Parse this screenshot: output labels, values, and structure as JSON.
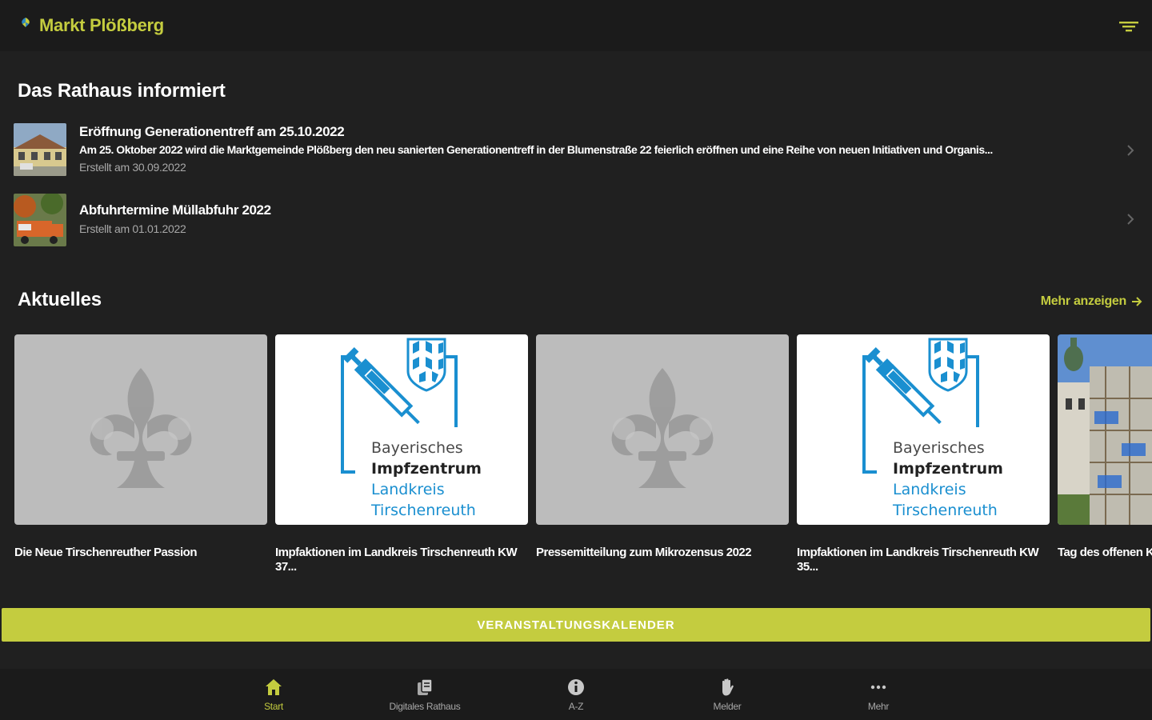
{
  "header": {
    "title": "Markt Plößberg",
    "filter_icon": "filter-icon"
  },
  "rathaus": {
    "title": "Das Rathaus informiert",
    "items": [
      {
        "title": "Eröffnung Generationentreff am 25.10.2022",
        "description": "Am 25. Oktober 2022 wird die Marktgemeinde Plößberg den neu sanierten Generationentreff in der Blumenstraße 22 feierlich eröffnen und eine Reihe von neuen Initiativen und Organis...",
        "date": "Erstellt am 30.09.2022"
      },
      {
        "title": "Abfuhrtermine Müllabfuhr 2022",
        "date": "Erstellt am 01.01.2022"
      }
    ]
  },
  "aktuelles": {
    "title": "Aktuelles",
    "more_label": "Mehr anzeigen",
    "cards": [
      {
        "title": "Die Neue Tirschenreuther Passion",
        "image": "placeholder-fleur-icon"
      },
      {
        "title": "Impfaktionen im Landkreis Tirschenreuth KW 37...",
        "image": "impfzentrum-logo"
      },
      {
        "title": "Pressemitteilung zum Mikrozensus 2022",
        "image": "placeholder-fleur-icon"
      },
      {
        "title": "Impfaktionen im Landkreis Tirschenreuth KW 35...",
        "image": "impfzentrum-logo"
      },
      {
        "title": "Tag des offenen Koopera...",
        "image": "church-photo"
      }
    ],
    "logo_text": {
      "line1": "Bayerisches",
      "line2": "Impfzentrum",
      "line3": "Landkreis",
      "line4": "Tirschenreuth"
    }
  },
  "calendar_button": "VERANSTALTUNGSKALENDER",
  "bottom_nav": [
    {
      "label": "Start",
      "icon": "home-icon",
      "active": true
    },
    {
      "label": "Digitales Rathaus",
      "icon": "documents-icon",
      "active": false
    },
    {
      "label": "A-Z",
      "icon": "info-icon",
      "active": false
    },
    {
      "label": "Melder",
      "icon": "hand-icon",
      "active": false
    },
    {
      "label": "Mehr",
      "icon": "more-icon",
      "active": false
    }
  ],
  "colors": {
    "accent": "#c4cc3f",
    "background": "#202020",
    "bar": "#1b1b1b",
    "muted_text": "#a8a8a8",
    "logo_blue": "#1a8fd0"
  }
}
